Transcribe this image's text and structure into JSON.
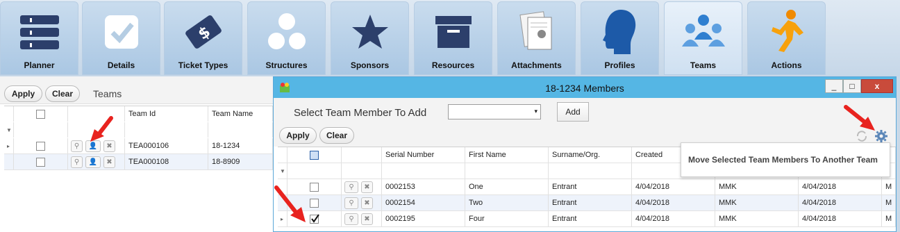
{
  "ribbon": {
    "tiles": [
      {
        "label": "Planner",
        "icon": "planner-icon"
      },
      {
        "label": "Details",
        "icon": "details-icon"
      },
      {
        "label": "Ticket Types",
        "icon": "ticket-types-icon"
      },
      {
        "label": "Structures",
        "icon": "structures-icon"
      },
      {
        "label": "Sponsors",
        "icon": "sponsors-icon"
      },
      {
        "label": "Resources",
        "icon": "resources-icon"
      },
      {
        "label": "Attachments",
        "icon": "attachments-icon"
      },
      {
        "label": "Profiles",
        "icon": "profiles-icon"
      },
      {
        "label": "Teams",
        "icon": "teams-icon"
      },
      {
        "label": "Actions",
        "icon": "actions-icon"
      }
    ]
  },
  "left_panel": {
    "apply_label": "Apply",
    "clear_label": "Clear",
    "group_title": "Teams",
    "columns": [
      "Team Id",
      "Team Name"
    ],
    "rows": [
      {
        "team_id": "TEA000106",
        "team_name": "18-1234"
      },
      {
        "team_id": "TEA000108",
        "team_name": "18-8909"
      }
    ]
  },
  "dialog": {
    "title": "18-1234 Members",
    "select_label": "Select Team Member To Add",
    "add_label": "Add",
    "apply_label": "Apply",
    "clear_label": "Clear",
    "tooltip": "Move Selected Team Members To Another Team",
    "window_buttons": {
      "minimize": "_",
      "maximize": "□",
      "close": "x"
    },
    "columns": [
      "Serial Number",
      "First Name",
      "Surname/Org.",
      "Created",
      "",
      "",
      ""
    ],
    "rows": [
      {
        "serial": "0002153",
        "first": "One",
        "surname": "Entrant",
        "created": "4/04/2018",
        "c5": "MMK",
        "c6": "4/04/2018",
        "c7": "M",
        "checked": false
      },
      {
        "serial": "0002154",
        "first": "Two",
        "surname": "Entrant",
        "created": "4/04/2018",
        "c5": "MMK",
        "c6": "4/04/2018",
        "c7": "M",
        "checked": false
      },
      {
        "serial": "0002195",
        "first": "Four",
        "surname": "Entrant",
        "created": "4/04/2018",
        "c5": "MMK",
        "c6": "4/04/2018",
        "c7": "M",
        "checked": true
      }
    ]
  },
  "colors": {
    "accent": "#55b6e4",
    "arrow": "#e8231f"
  }
}
